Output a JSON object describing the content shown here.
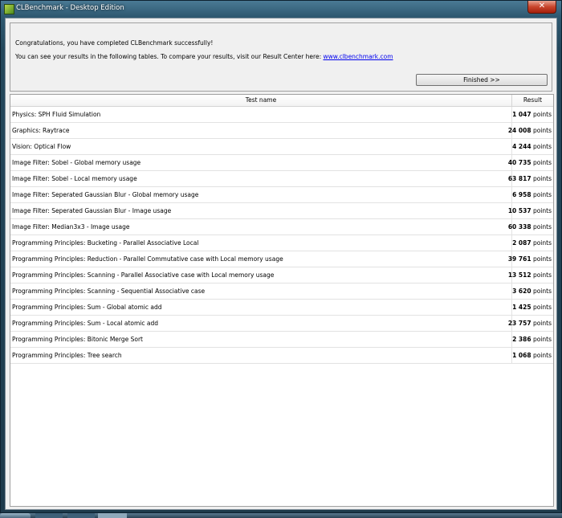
{
  "window": {
    "title": "CLBenchmark - Desktop Edition",
    "close_label": "✕"
  },
  "info": {
    "line1": "Congratulations, you have completed CLBenchmark successfully!",
    "line2_prefix": "You can see your results in the following tables. To compare your results, visit our Result Center here: ",
    "link_text": "www.clbenchmark.com",
    "finish_label": "Finished >>"
  },
  "table": {
    "headers": {
      "name": "Test name",
      "result": "Result"
    },
    "unit": "points",
    "rows": [
      {
        "name": "Physics: SPH Fluid Simulation",
        "value": "1 047"
      },
      {
        "name": "Graphics: Raytrace",
        "value": "24 008"
      },
      {
        "name": "Vision: Optical Flow",
        "value": "4 244"
      },
      {
        "name": "Image Filter: Sobel - Global memory usage",
        "value": "40 735"
      },
      {
        "name": "Image Filter: Sobel - Local memory usage",
        "value": "63 817"
      },
      {
        "name": "Image Filter: Seperated Gaussian Blur - Global memory usage",
        "value": "6 958"
      },
      {
        "name": "Image Filter: Seperated Gaussian Blur - Image usage",
        "value": "10 537"
      },
      {
        "name": "Image Filter: Median3x3 - Image usage",
        "value": "60 338"
      },
      {
        "name": "Programming Principles: Bucketing - Parallel Associative Local",
        "value": "2 087"
      },
      {
        "name": "Programming Principles: Reduction - Parallel Commutative case with Local memory usage",
        "value": "39 761"
      },
      {
        "name": "Programming Principles: Scanning - Parallel Associative case with Local memory usage",
        "value": "13 512"
      },
      {
        "name": "Programming Principles: Scanning - Sequential Associative case",
        "value": "3 620"
      },
      {
        "name": "Programming Principles: Sum - Global atomic add",
        "value": "1 425"
      },
      {
        "name": "Programming Principles: Sum - Local atomic add",
        "value": "23 757"
      },
      {
        "name": "Programming Principles: Bitonic Merge Sort",
        "value": "2 386"
      },
      {
        "name": "Programming Principles: Tree search",
        "value": "1 068"
      }
    ]
  },
  "colors": {
    "link": "#0000ee",
    "close_button": "#c8452c",
    "frame": "#2e5870"
  }
}
